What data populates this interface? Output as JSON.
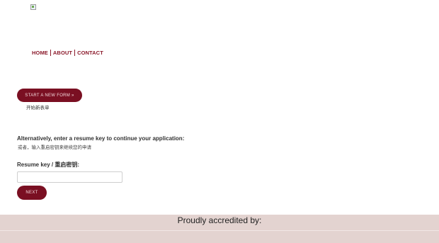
{
  "header": {
    "logo": "broken-image-icon"
  },
  "nav": {
    "home": "HOME",
    "about": "ABOUT",
    "contact": "CONTACT"
  },
  "start": {
    "button_label": "START A NEW FORM »",
    "subtitle": "开始新表单"
  },
  "resume": {
    "heading": "Alternatively, enter a resume key to continue your application:",
    "heading_cn": "或者，输入重启密钥来继续您的申请",
    "key_label": "Resume key / 重启密钥:",
    "key_value": "",
    "next_label": "NEXT"
  },
  "footer": {
    "accredited_label": "Proudly accredited by:"
  },
  "colors": {
    "brand": "#7a0f22",
    "nav": "#8b1a2b",
    "footer_bg": "#e3d3d0"
  }
}
